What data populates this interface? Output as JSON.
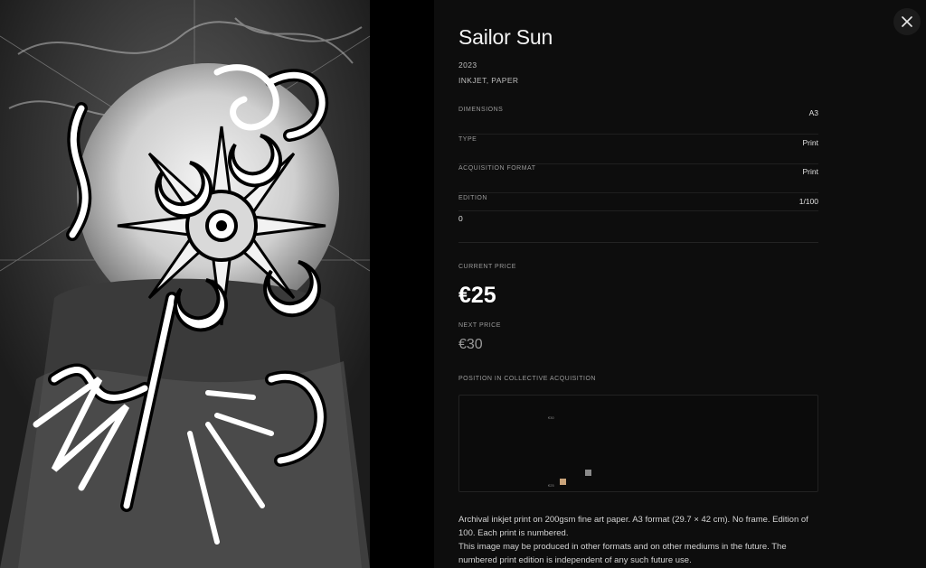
{
  "artwork": {
    "alt_icon": "artwork-image"
  },
  "close": {
    "icon": "close-icon",
    "glyph": "✕"
  },
  "title": "Sailor Sun",
  "year": "2023",
  "medium": "INKJET, PAPER",
  "specs": [
    {
      "label": "DIMENSIONS",
      "value": "A3"
    },
    {
      "label": "TYPE",
      "value": "Print"
    },
    {
      "label": "ACQUISITION FORMAT",
      "value": "Print"
    },
    {
      "label": "EDITION",
      "value": "1/100"
    }
  ],
  "edition_extra": "0",
  "current_price_label": "CURRENT PRICE",
  "current_price": "€25",
  "next_price_label": "NEXT PRICE",
  "next_price": "€30",
  "position_label": "POSITION IN COLLECTIVE ACQUISITION",
  "position_ticks": {
    "top": "€30",
    "bottom": "€25"
  },
  "description": [
    "Archival inkjet print on 200gsm fine art paper. A3 format (29.7 × 42 cm). No frame. Edition of 100. Each print is numbered.",
    "This image may be produced in other formats and on other mediums in the future. The numbered print edition is independent of any such future use."
  ],
  "colors": {
    "panel_bg": "#0d0d0d",
    "accent_white": "#ffffff",
    "muted": "#9a9a9a"
  }
}
